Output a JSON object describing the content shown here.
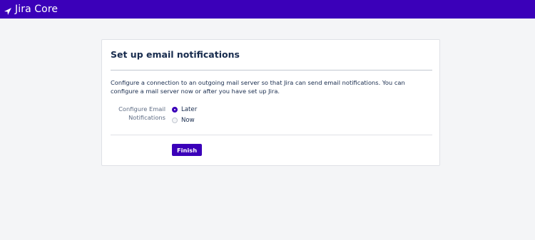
{
  "header": {
    "logo_text": "Jira Core",
    "logo_icon": "jira-triangle-icon",
    "bar_color": "#3b00b9"
  },
  "card": {
    "title": "Set up email notifications",
    "description": "Configure a connection to an outgoing mail server so that Jira can send email notifications. You can configure a mail server now or after you have set up Jira.",
    "field_label": "Configure Email Notifications",
    "options": [
      {
        "label": "Later",
        "checked": true
      },
      {
        "label": "Now",
        "checked": false
      }
    ],
    "finish_label": "Finish"
  }
}
